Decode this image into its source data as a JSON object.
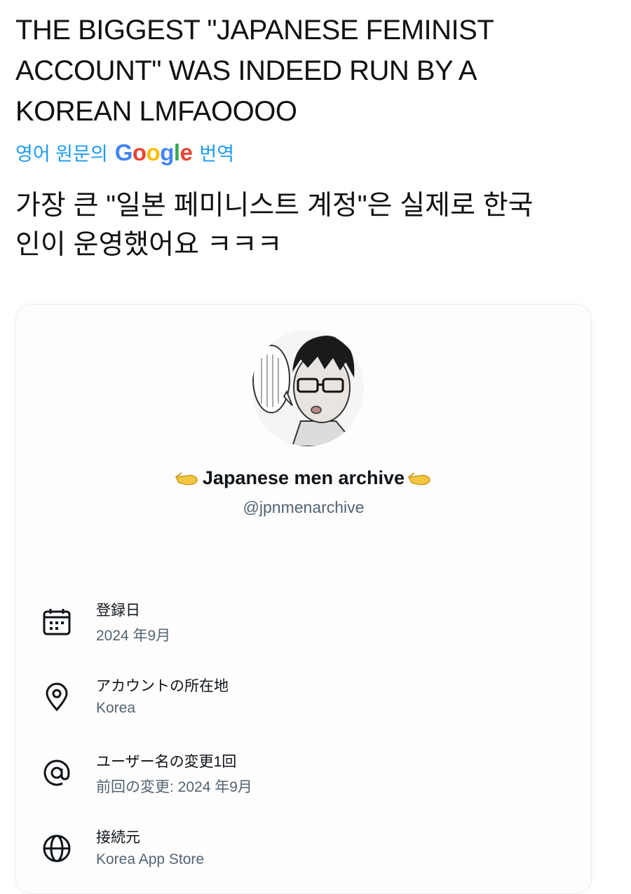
{
  "tweet": {
    "text": "THE BIGGEST \"JAPANESE FEMINIST ACCOUNT\" WAS INDEED RUN BY A KOREAN LMFAOOOO",
    "translate_prefix": "영어 원문의",
    "translate_brand": "Google",
    "translate_suffix": "번역",
    "translated_text": "가장 큰 \"일본 페미니스트 계정\"은 실제로 한국인이 운영했어요 ㅋㅋㅋ"
  },
  "profile": {
    "display_name": "Japanese men archive",
    "handle": "@jpnmenarchive"
  },
  "about": [
    {
      "icon": "calendar-icon",
      "label": "登録日",
      "value": "2024 年9月"
    },
    {
      "icon": "location-pin-icon",
      "label": "アカウントの所在地",
      "value": "Korea"
    },
    {
      "icon": "at-sign-icon",
      "label": "ユーザー名の変更1回",
      "value": "前回の変更: 2024 年9月"
    },
    {
      "icon": "globe-icon",
      "label": "接続元",
      "value": "Korea App Store"
    }
  ],
  "colors": {
    "link": "#1d9bf0",
    "secondary_text": "#536471",
    "google_blue": "#4285F4",
    "google_red": "#EA4335",
    "google_yellow": "#FBBC05",
    "google_green": "#34A853"
  }
}
